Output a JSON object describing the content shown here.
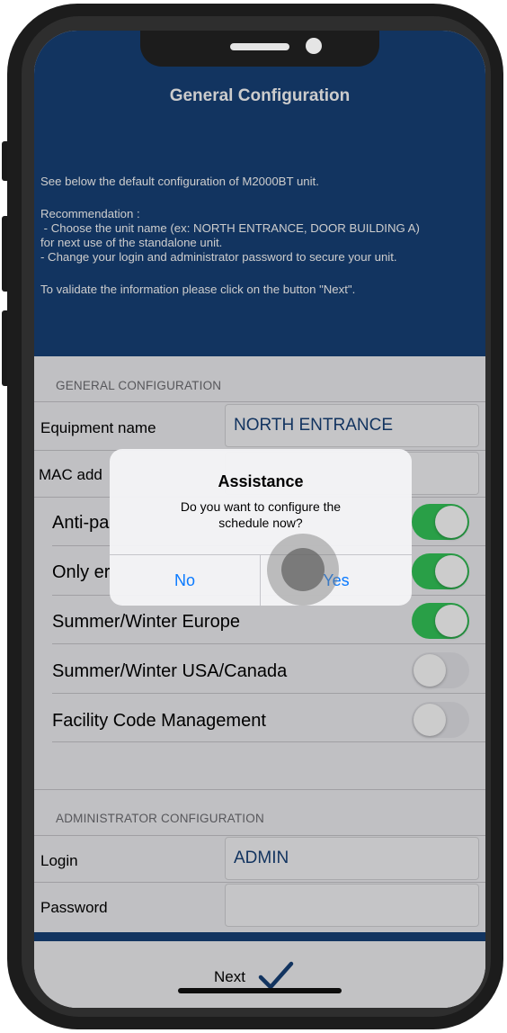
{
  "nav": {
    "title": "General Configuration"
  },
  "info": {
    "line1": "See below the default configuration of M2000BT unit.",
    "line2": "Recommendation :",
    "line3": " - Choose the unit name (ex: NORTH ENTRANCE, DOOR BUILDING A)",
    "line4": "for next use of the standalone unit.",
    "line5": "- Change your login and administrator password to secure your unit.",
    "line6": "To validate the information please click on the button \"Next\"."
  },
  "general": {
    "header": "GENERAL CONFIGURATION",
    "equipment_label": "Equipment name",
    "equipment_value": "NORTH ENTRANCE",
    "mac_label": "MAC add",
    "toggles": [
      {
        "label": "Anti-pa",
        "on": true
      },
      {
        "label": "Only er",
        "on": true
      },
      {
        "label": "Summer/Winter Europe",
        "on": true
      },
      {
        "label": "Summer/Winter USA/Canada",
        "on": false
      },
      {
        "label": "Facility Code Management",
        "on": false
      }
    ]
  },
  "admin": {
    "header": "ADMINISTRATOR CONFIGURATION",
    "login_label": "Login",
    "login_value": "ADMIN",
    "password_label": "Password"
  },
  "footer": {
    "next_label": "Next"
  },
  "alert": {
    "title": "Assistance",
    "message_line1": "Do you want to configure the",
    "message_line2": "schedule now?",
    "no_label": "No",
    "yes_label": "Yes"
  },
  "colors": {
    "brand": "#174179",
    "toggle_on": "#34c759",
    "toggle_off": "#e5e5ea",
    "link": "#0a7aff"
  },
  "icons": {
    "next": "checkmark-icon"
  }
}
